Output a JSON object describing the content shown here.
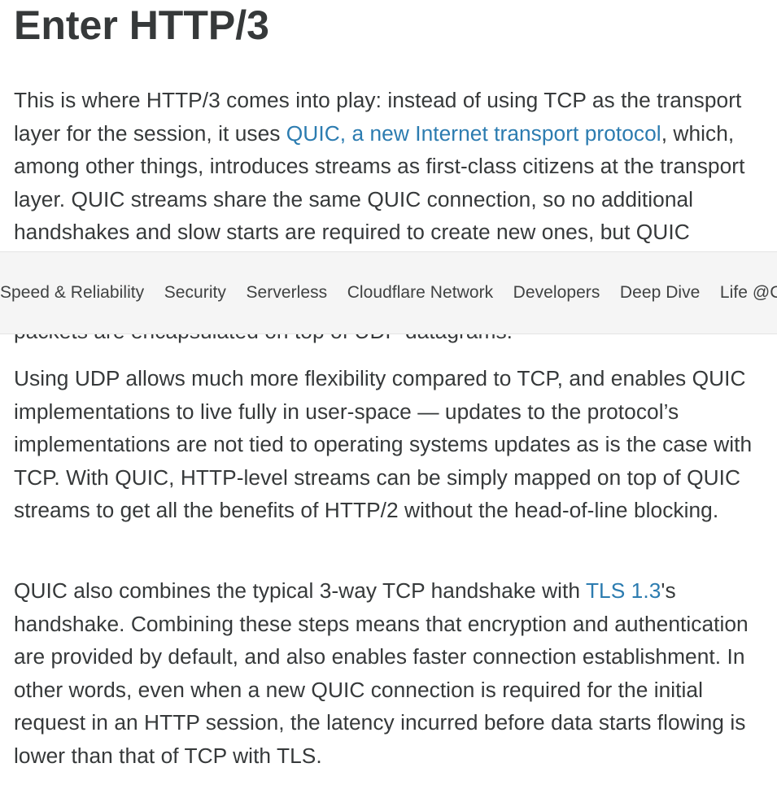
{
  "article": {
    "heading": "Enter HTTP/3",
    "paragraph1": {
      "before_link": "This is where HTTP/3 comes into play: instead of using TCP as the transport layer for the session, it uses ",
      "link_text": "QUIC, a new Internet transport protocol",
      "after_link": ", which, among other things, introduces streams as first-class citizens at the transport layer. QUIC streams share the same QUIC connection, so no additional handshakes and slow starts are required to create new ones, but QUIC streams are delivered independently such that in most cases packet loss affecting one stream doesn't affect others. This is possible because QUIC packets are encapsulated on top of UDP datagrams."
    },
    "paragraph2": "Using UDP allows much more flexibility compared to TCP, and enables QUIC implementations to live fully in user-space — updates to the protocol’s implementations are not tied to operating systems updates as is the case with TCP. With QUIC, HTTP-level streams can be simply mapped on top of QUIC streams to get all the benefits of HTTP/2 without the head-of-line blocking.",
    "paragraph3": {
      "before_link": "QUIC also combines the typical 3-way TCP handshake with ",
      "link_text": "TLS 1.3",
      "after_link": "'s handshake. Combining these steps means that encryption and authentication are provided by default, and also enables faster connection establishment. In other words, even when a new QUIC connection is required for the initial request in an HTTP session, the latency incurred before data starts flowing is lower than that of TCP with TLS."
    }
  },
  "category_nav": {
    "items": [
      "Speed & Reliability",
      "Security",
      "Serverless",
      "Cloudflare Network",
      "Developers",
      "Deep Dive",
      "Life @Cloudflare"
    ]
  },
  "colors": {
    "text": "#36393a",
    "link": "#2c7cb0",
    "nav_background": "#f5f5f5"
  }
}
